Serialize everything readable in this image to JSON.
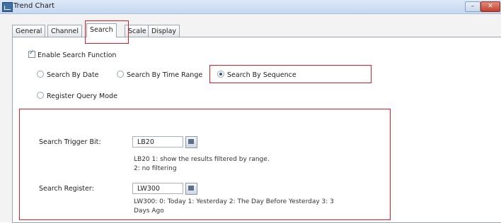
{
  "window": {
    "title": "Trend Chart",
    "minimize_glyph": "–",
    "close_glyph": "✕"
  },
  "tabs": [
    "General",
    "Channel",
    "Search",
    "Scale",
    "Display"
  ],
  "active_tab": "Search",
  "search": {
    "enable_label": "Enable Search Function",
    "enable_checked": true,
    "modes": [
      {
        "label": "Search By Date",
        "selected": false
      },
      {
        "label": "Search By Time Range",
        "selected": false
      },
      {
        "label": "Search By Sequence",
        "selected": true
      },
      {
        "label": "Register Query Mode",
        "selected": false
      }
    ],
    "trigger_bit": {
      "label": "Search Trigger Bit:",
      "value": "LB20",
      "note_line1": "LB20 1: show the results filtered by range.",
      "note_line2": "2: no filtering"
    },
    "register": {
      "label": "Search Register:",
      "value": "LW300",
      "note_line1": "LW300: 0: Today  1: Yesterday  2: The Day Before Yesterday 3: 3",
      "note_line2": "Days Ago"
    }
  },
  "colors": {
    "highlight": "#d41f26",
    "titlebar": "#c6d9f1"
  }
}
